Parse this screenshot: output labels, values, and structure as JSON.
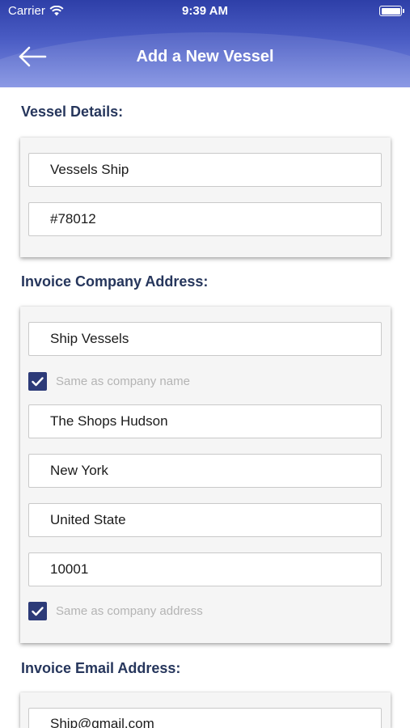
{
  "status_bar": {
    "carrier": "Carrier",
    "time": "9:39 AM"
  },
  "header": {
    "title": "Add a New Vessel",
    "back_icon": "arrow-left-icon"
  },
  "colors": {
    "header_top": "#2e3fa8",
    "header_bottom": "#7f8fe2",
    "section_title": "#26365c",
    "checkbox": "#2c3a78"
  },
  "vessel_details": {
    "title": "Vessel Details:",
    "vessel_name": "Vessels Ship",
    "vessel_number": "#78012"
  },
  "invoice_company_address": {
    "title": "Invoice Company Address:",
    "company_name": "Ship Vessels",
    "same_as_company_name": {
      "label": "Same as company name",
      "checked": true
    },
    "street": "The Shops Hudson",
    "city": "New York",
    "country": "United State",
    "zip": "10001",
    "same_as_company_address": {
      "label": "Same as company address",
      "checked": true
    }
  },
  "invoice_email_address": {
    "title": "Invoice Email Address:",
    "email": "Ship@gmail.com"
  }
}
